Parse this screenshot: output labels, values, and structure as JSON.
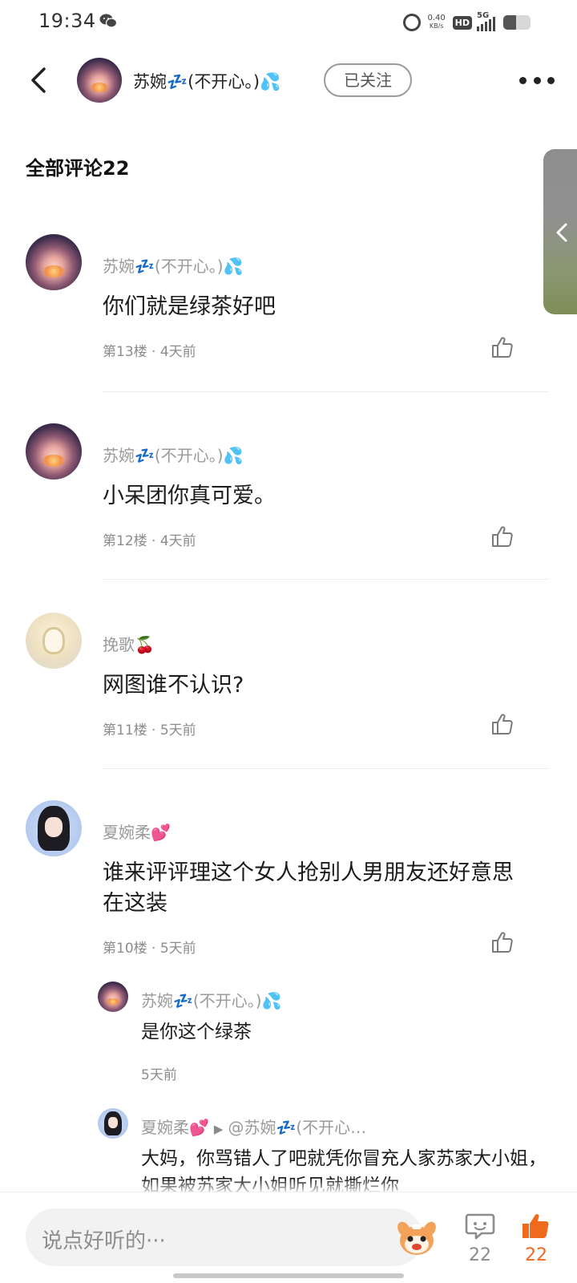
{
  "status_bar": {
    "time": "19:34",
    "speed_value": "0.40",
    "speed_unit": "KB/s",
    "hd": "HD",
    "network": "5G",
    "icons": [
      "wechat-icon",
      "alarm-icon",
      "signal-icon",
      "battery-icon"
    ]
  },
  "header": {
    "username": "苏婉💤(不开心。)💦",
    "follow_label": "已关注",
    "icons": [
      "back-icon",
      "more-icon"
    ]
  },
  "comments_section": {
    "title": "全部评论22"
  },
  "comments": [
    {
      "author": "苏婉💤(不开心。)💦",
      "text": "你们就是绿茶好吧",
      "meta": "第13楼 · 4天前"
    },
    {
      "author": "苏婉💤(不开心。)💦",
      "text": "小呆团你真可爱。",
      "meta": "第12楼 · 4天前"
    },
    {
      "author": "挽歌🍒",
      "text": "网图谁不认识?",
      "meta": "第11楼 · 5天前"
    },
    {
      "author": "夏婉柔💕",
      "text": "谁来评评理这个女人抢别人男朋友还好意思在这装",
      "meta": "第10楼 · 5天前",
      "replies": [
        {
          "author": "苏婉💤(不开心。)💦",
          "text": "是你这个绿茶",
          "meta": "5天前"
        },
        {
          "author": "夏婉柔💕",
          "reply_to": "@苏婉💤(不开心…",
          "text": "大妈，你骂错人了吧就凭你冒充人家苏家大小姐，如果被苏家大小姐听见就撕烂你"
        }
      ]
    }
  ],
  "bottom_bar": {
    "input_placeholder": "说点好听的···",
    "comment_count": "22",
    "like_count": "22",
    "accent_color": "#f06a1e"
  }
}
